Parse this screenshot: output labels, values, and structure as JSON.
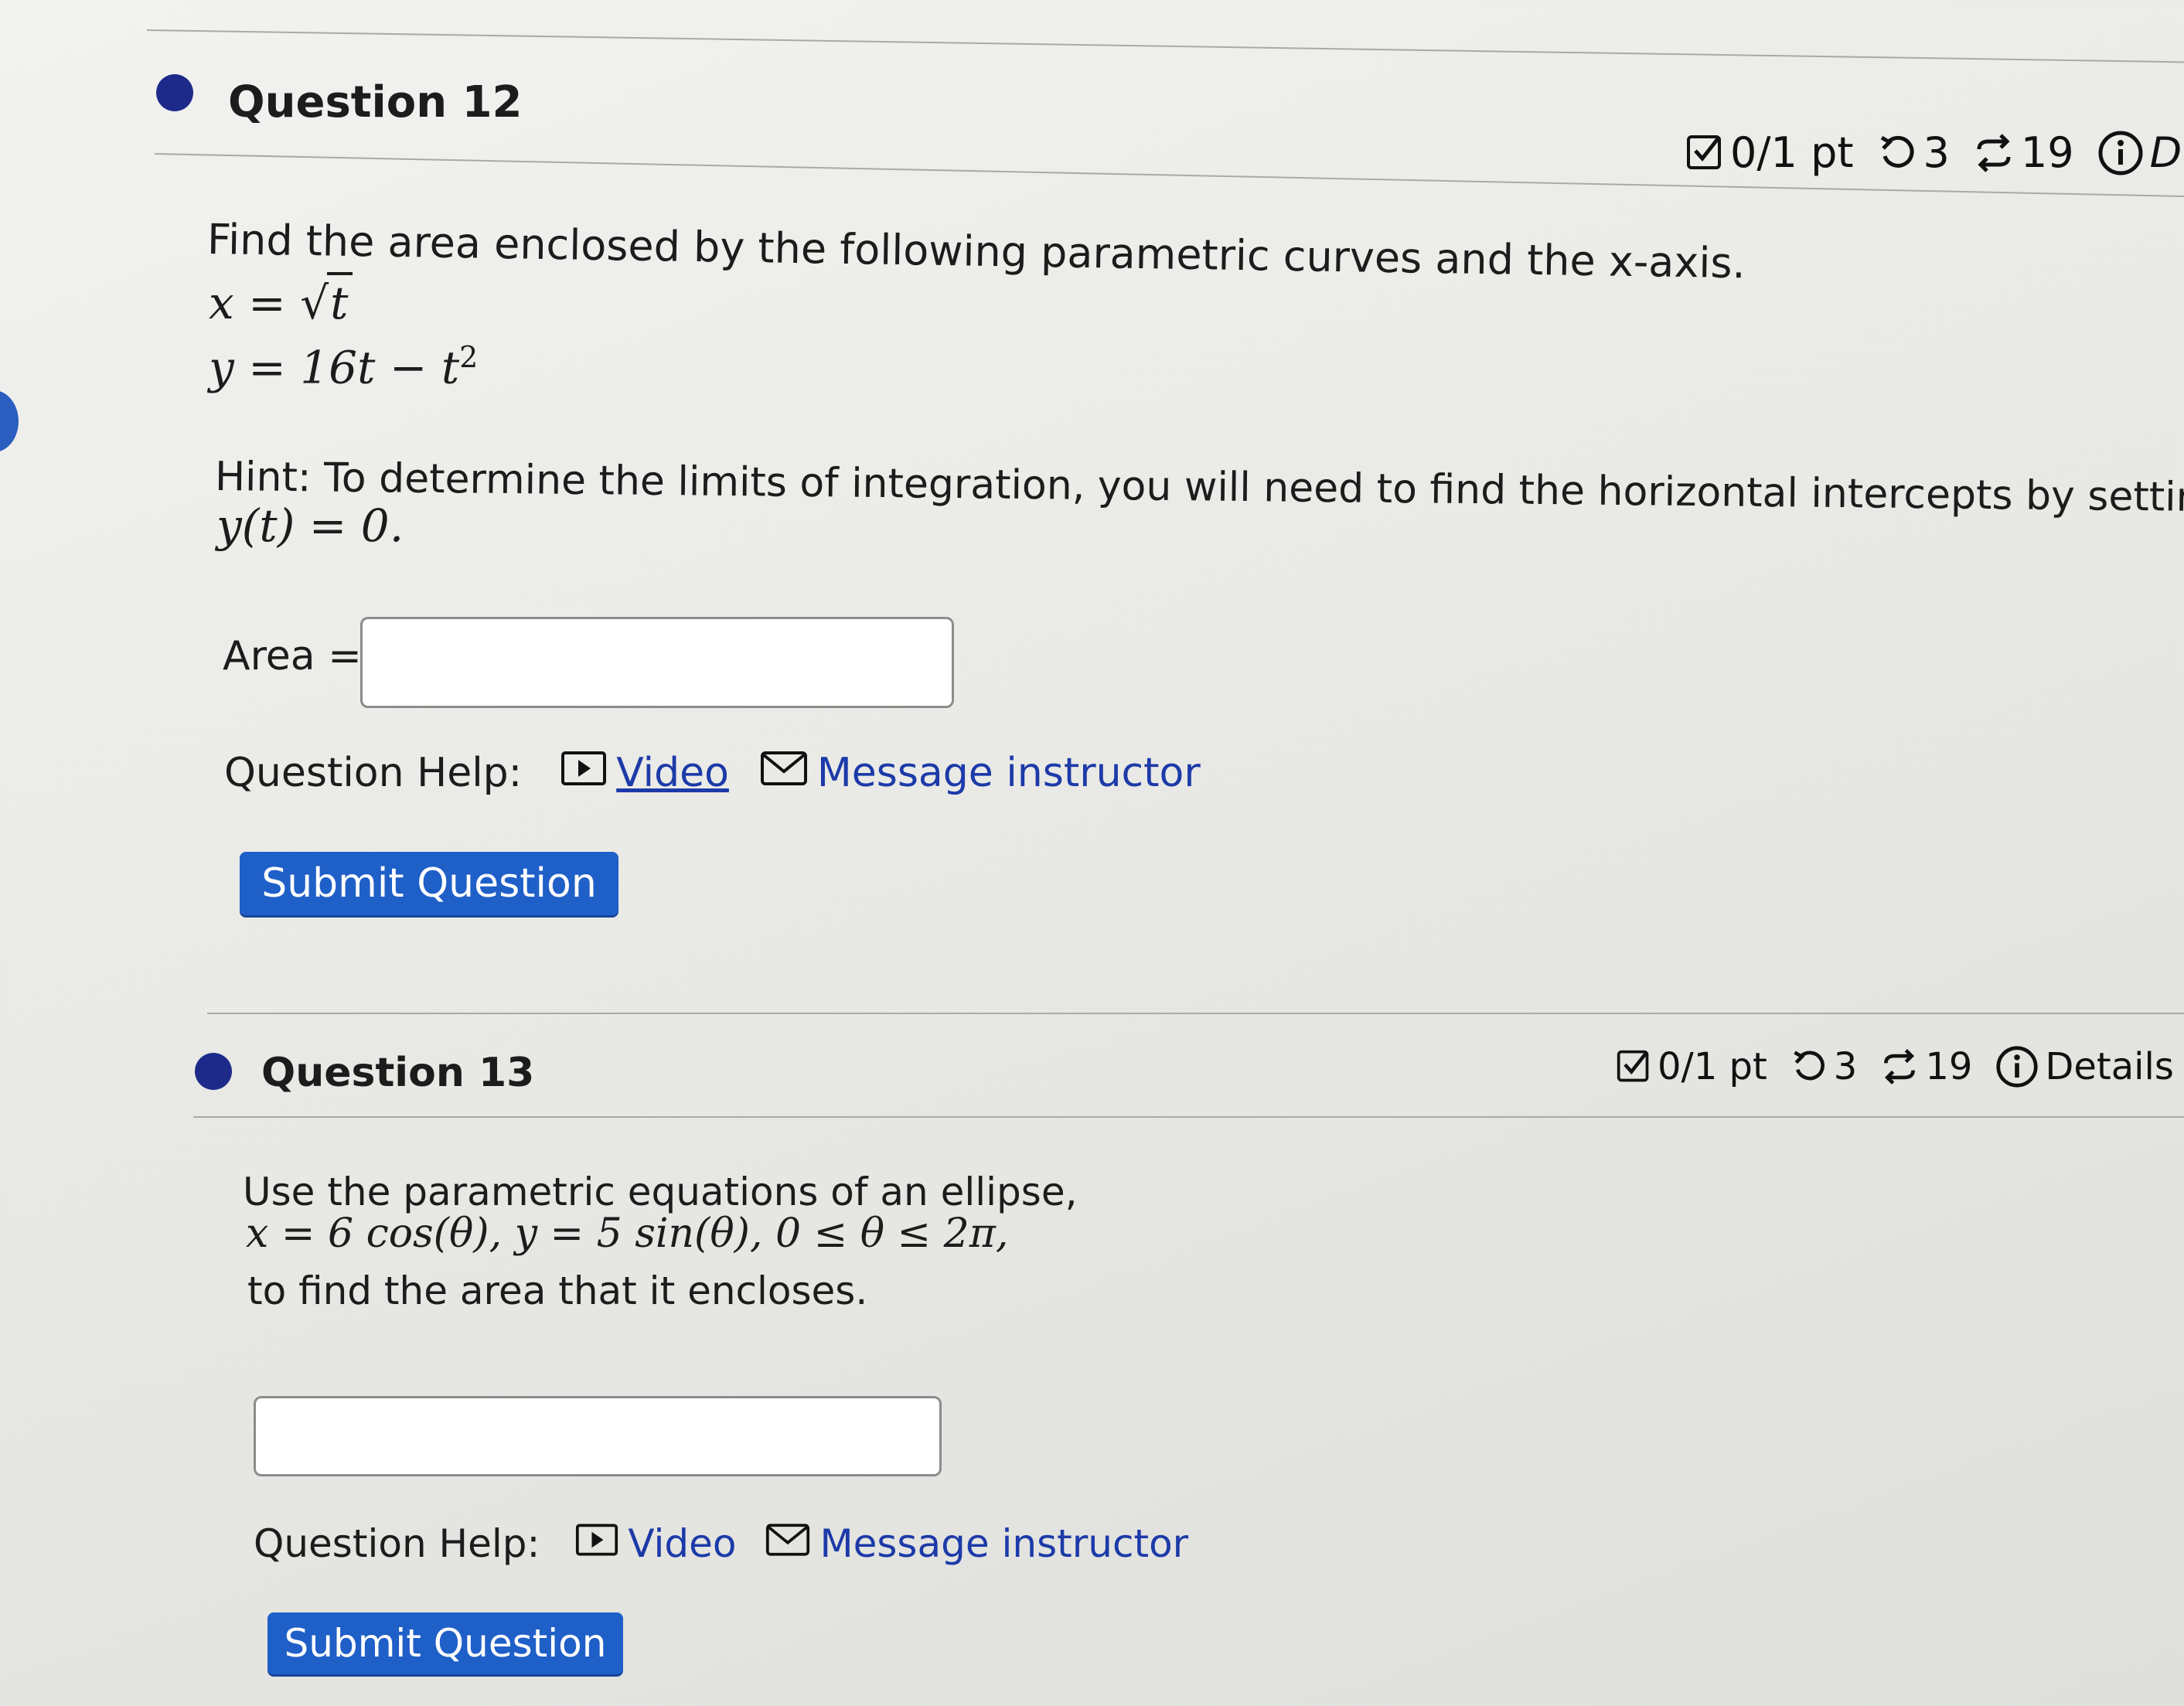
{
  "q12": {
    "title": "Question 12",
    "points": "0/1 pt",
    "retries": "3",
    "attempts": "19",
    "details": "D",
    "prompt": "Find the area enclosed by the following parametric curves and the x-axis.",
    "eq_x_lhs": "x",
    "eq_x_rhs": "t",
    "eq_y_lhs": "y",
    "eq_y_rhs": "16t − t",
    "eq_y_exp": "2",
    "hint_line1": "Hint: To determine the limits of integration, you will need to find the horizontal intercepts by setting",
    "hint_line2": "y(t) = 0.",
    "answer_label": "Area =",
    "answer_value": "",
    "help_label": "Question Help:",
    "video_label": "Video",
    "message_label": "Message instructor",
    "submit_label": "Submit Question"
  },
  "q13": {
    "title": "Question 13",
    "points": "0/1 pt",
    "retries": "3",
    "attempts": "19",
    "details": "Details",
    "prompt_line1": "Use the parametric equations of an ellipse,",
    "prompt_math": "x = 6 cos(θ),   y = 5 sin(θ),   0 ≤ θ ≤ 2π,",
    "prompt_line3": "to find the area that it encloses.",
    "answer_value": "",
    "help_label": "Question Help:",
    "video_label": "Video",
    "message_label": "Message instructor",
    "submit_label": "Submit Question"
  },
  "colors": {
    "accent": "#1f5fc8",
    "link": "#1c3aa8",
    "dot": "#1d2a8a"
  },
  "icons": [
    "checkbox-icon",
    "retry-icon",
    "attempts-icon",
    "info-icon",
    "video-play-icon",
    "mail-icon"
  ]
}
